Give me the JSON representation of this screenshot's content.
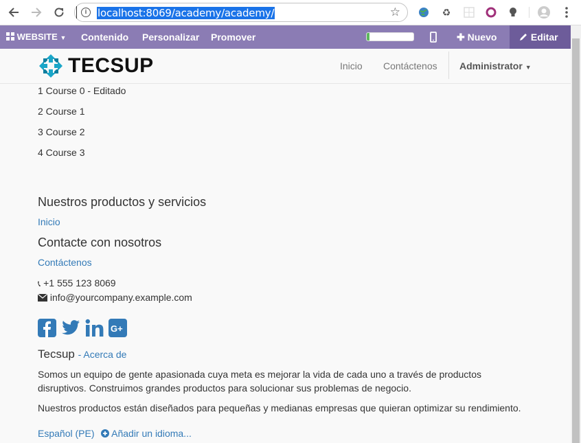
{
  "browser": {
    "url": "localhost:8069/academy/academy/"
  },
  "odoo_bar": {
    "website_label": "WEBSITE",
    "contenido_label": "Contenido",
    "personalizar_label": "Personalizar",
    "promover_label": "Promover",
    "nuevo_label": "Nuevo",
    "editar_label": "Editar",
    "progress_fraction": 0.06,
    "bar_color": "#8b7cb4"
  },
  "site": {
    "logo_text": "TECSUP",
    "menu": [
      "Inicio",
      "Contáctenos"
    ],
    "user": "Administrator"
  },
  "courses": [
    "1 Course 0 - Editado",
    "2 Course 1",
    "3 Course 2",
    "4 Course 3"
  ],
  "footer": {
    "products_title": "Nuestros productos y servicios",
    "products_link": "Inicio",
    "contact_title": "Contacte con nosotros",
    "contact_link": "Contáctenos",
    "phone": "+1 555 123 8069",
    "email": "info@yourcompany.example.com",
    "company": "Tecsup",
    "about_link": "- Acerca de",
    "about_p1": "Somos un equipo de gente apasionada cuya meta es mejorar la vida de cada uno a través de productos disruptivos. Construimos grandes productos para solucionar sus problemas de negocio.",
    "about_p2": "Nuestros productos están diseñados para pequeñas y medianas empresas que quieran optimizar su rendimiento.",
    "language": "Español (PE)",
    "add_language": "Añadir un idioma...",
    "link_color": "#337ab7",
    "social_color": "#337ab7"
  }
}
